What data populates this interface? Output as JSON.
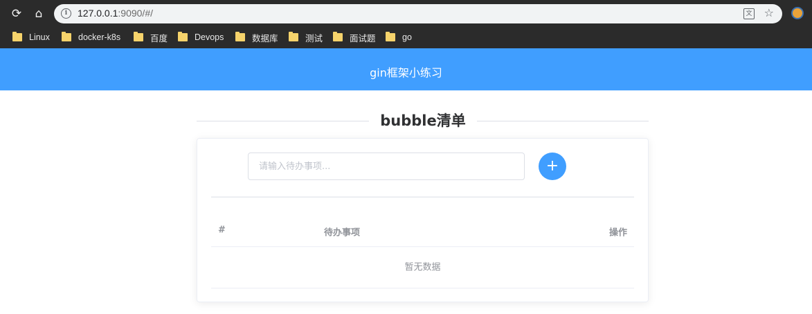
{
  "browser": {
    "back_icon": "refresh-icon",
    "url_host": "127.0.0.1",
    "url_rest": ":9090/#/",
    "bookmarks": [
      "Linux",
      "docker-k8s",
      "百度",
      "Devops",
      "数据库",
      "测试",
      "面试题",
      "go"
    ]
  },
  "app": {
    "header_title": "gin框架小练习",
    "header_color": "#409eff"
  },
  "main": {
    "section_title": "bubble清单",
    "input_placeholder": "请输入待办事项...",
    "input_value": "",
    "add_button_label": "+",
    "table": {
      "columns": [
        "#",
        "待办事项",
        "操作"
      ],
      "rows": [],
      "empty_text": "暂无数据"
    }
  }
}
